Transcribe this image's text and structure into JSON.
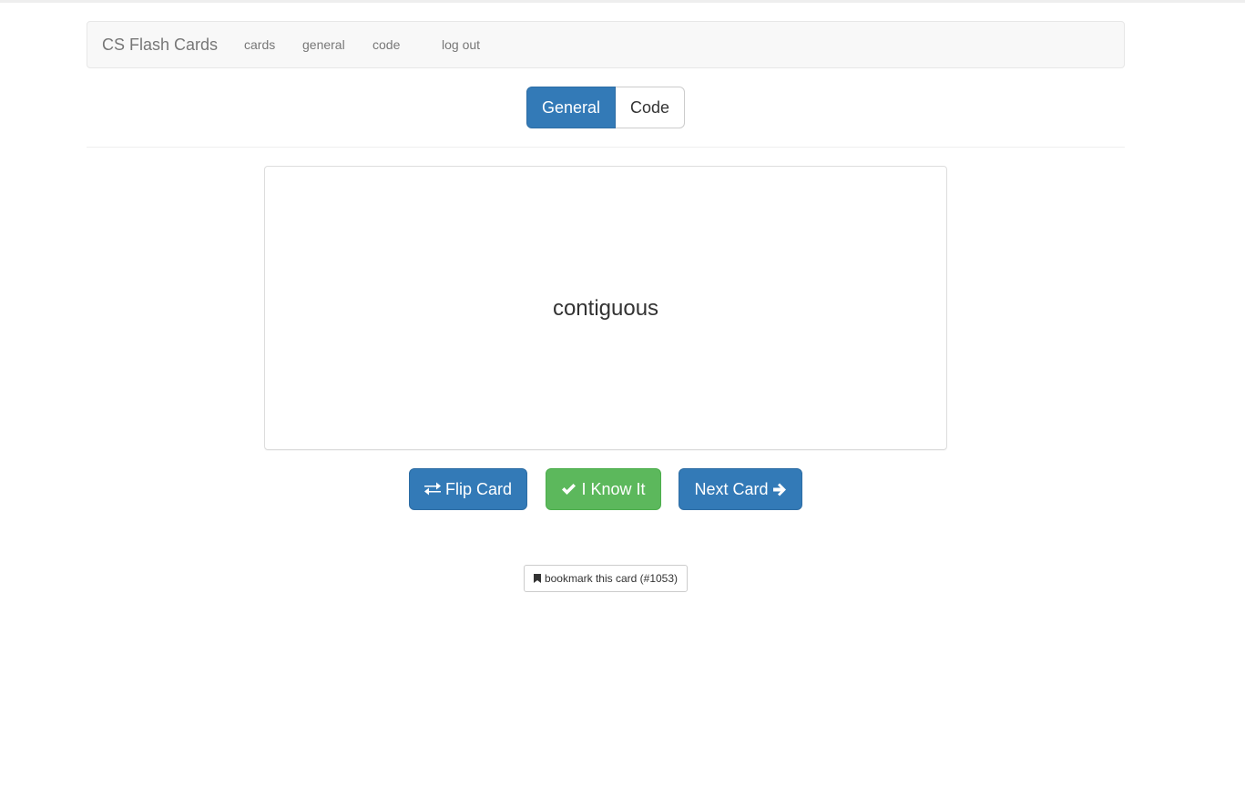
{
  "navbar": {
    "brand": "CS Flash Cards",
    "links": [
      "cards",
      "general",
      "code",
      "log out"
    ]
  },
  "mode_toggle": {
    "options": [
      "General",
      "Code"
    ],
    "selected": "General"
  },
  "card": {
    "term": "contiguous"
  },
  "actions": {
    "flip_label": "Flip Card",
    "know_label": "I Know It",
    "next_label": "Next Card"
  },
  "bookmark": {
    "label": "bookmark this card (#1053)"
  },
  "icons": {
    "flip": "exchange-icon",
    "know": "check-icon",
    "next": "arrow-right-icon",
    "bookmark": "bookmark-icon"
  },
  "colors": {
    "primary": "#337ab7",
    "success": "#5cb85c",
    "navbar_bg": "#f8f8f8"
  }
}
